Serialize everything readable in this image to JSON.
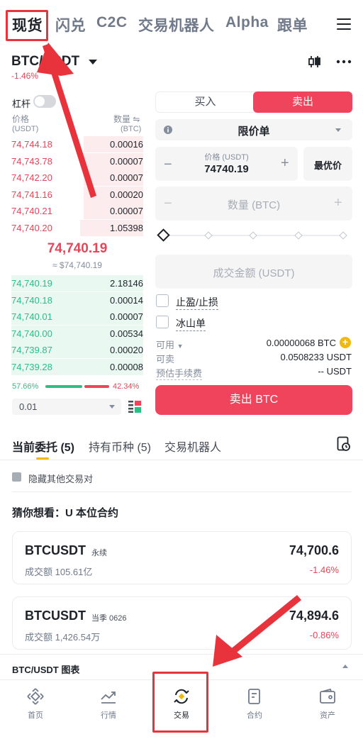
{
  "top_nav": {
    "tabs": [
      "现货",
      "闪兑",
      "C2C",
      "交易机器人",
      "Alpha",
      "跟单"
    ],
    "active": "现货"
  },
  "pair": {
    "symbol": "BTC/USDT",
    "change": "-1.46%"
  },
  "leverage_label": "杠杆",
  "order_book": {
    "price_header": "价格",
    "price_unit": "(USDT)",
    "qty_header": "数量",
    "qty_unit": "(BTC)",
    "asks": [
      {
        "price": "74,744.18",
        "qty": "0.00016",
        "depth": 0.45
      },
      {
        "price": "74,743.78",
        "qty": "0.00007",
        "depth": 0.45
      },
      {
        "price": "74,742.20",
        "qty": "0.00007",
        "depth": 0.45
      },
      {
        "price": "74,741.16",
        "qty": "0.00020",
        "depth": 0.45
      },
      {
        "price": "74,740.21",
        "qty": "0.00007",
        "depth": 0.45
      },
      {
        "price": "74,740.20",
        "qty": "1.05398",
        "depth": 0.48
      }
    ],
    "last_price": "74,740.19",
    "last_price_usd": "≈ $74,740.19",
    "bids": [
      {
        "price": "74,740.19",
        "qty": "2.18146",
        "depth": 1.0
      },
      {
        "price": "74,740.18",
        "qty": "0.00014",
        "depth": 1.0
      },
      {
        "price": "74,740.01",
        "qty": "0.00007",
        "depth": 1.0
      },
      {
        "price": "74,740.00",
        "qty": "0.00534",
        "depth": 1.0
      },
      {
        "price": "74,739.87",
        "qty": "0.00020",
        "depth": 1.0
      },
      {
        "price": "74,739.28",
        "qty": "0.00008",
        "depth": 1.0
      }
    ],
    "buy_ratio": "57.66%",
    "sell_ratio": "42.34%",
    "buy_ratio_value": 0.5766,
    "precision": "0.01"
  },
  "form": {
    "buy_label": "买入",
    "sell_label": "卖出",
    "order_type": "限价单",
    "price_label": "价格 (USDT)",
    "price_value": "74740.19",
    "best_price": "最优价",
    "qty_placeholder": "数量 (BTC)",
    "amount_placeholder": "成交金额 (USDT)",
    "tp_sl": "止盈/止损",
    "iceberg": "冰山单",
    "available_label": "可用",
    "available_value": "0.00000068 BTC",
    "can_sell_label": "可卖",
    "can_sell_value": "0.0508233 USDT",
    "fee_label": "预估手续费",
    "fee_value": "-- USDT",
    "submit": "卖出 BTC"
  },
  "lower_tabs": [
    "当前委托 (5)",
    "持有币种 (5)",
    "交易机器人"
  ],
  "hide_pairs": "隐藏其他交易对",
  "suggest_title": "猜你想看：U 本位合约",
  "cards": [
    {
      "symbol": "BTCUSDT",
      "tag": "永续",
      "volume": "成交额 105.61亿",
      "price": "74,700.6",
      "change": "-1.46%"
    },
    {
      "symbol": "BTCUSDT",
      "tag": "当季 0626",
      "volume": "成交额 1,426.54万",
      "price": "74,894.6",
      "change": "-0.86%"
    }
  ],
  "chart_bar": "BTC/USDT 图表",
  "bottom_nav": [
    "首页",
    "行情",
    "交易",
    "合约",
    "资产"
  ],
  "colors": {
    "red": "#f0445c",
    "green": "#2ebd85",
    "highlight": "#e8333c"
  }
}
